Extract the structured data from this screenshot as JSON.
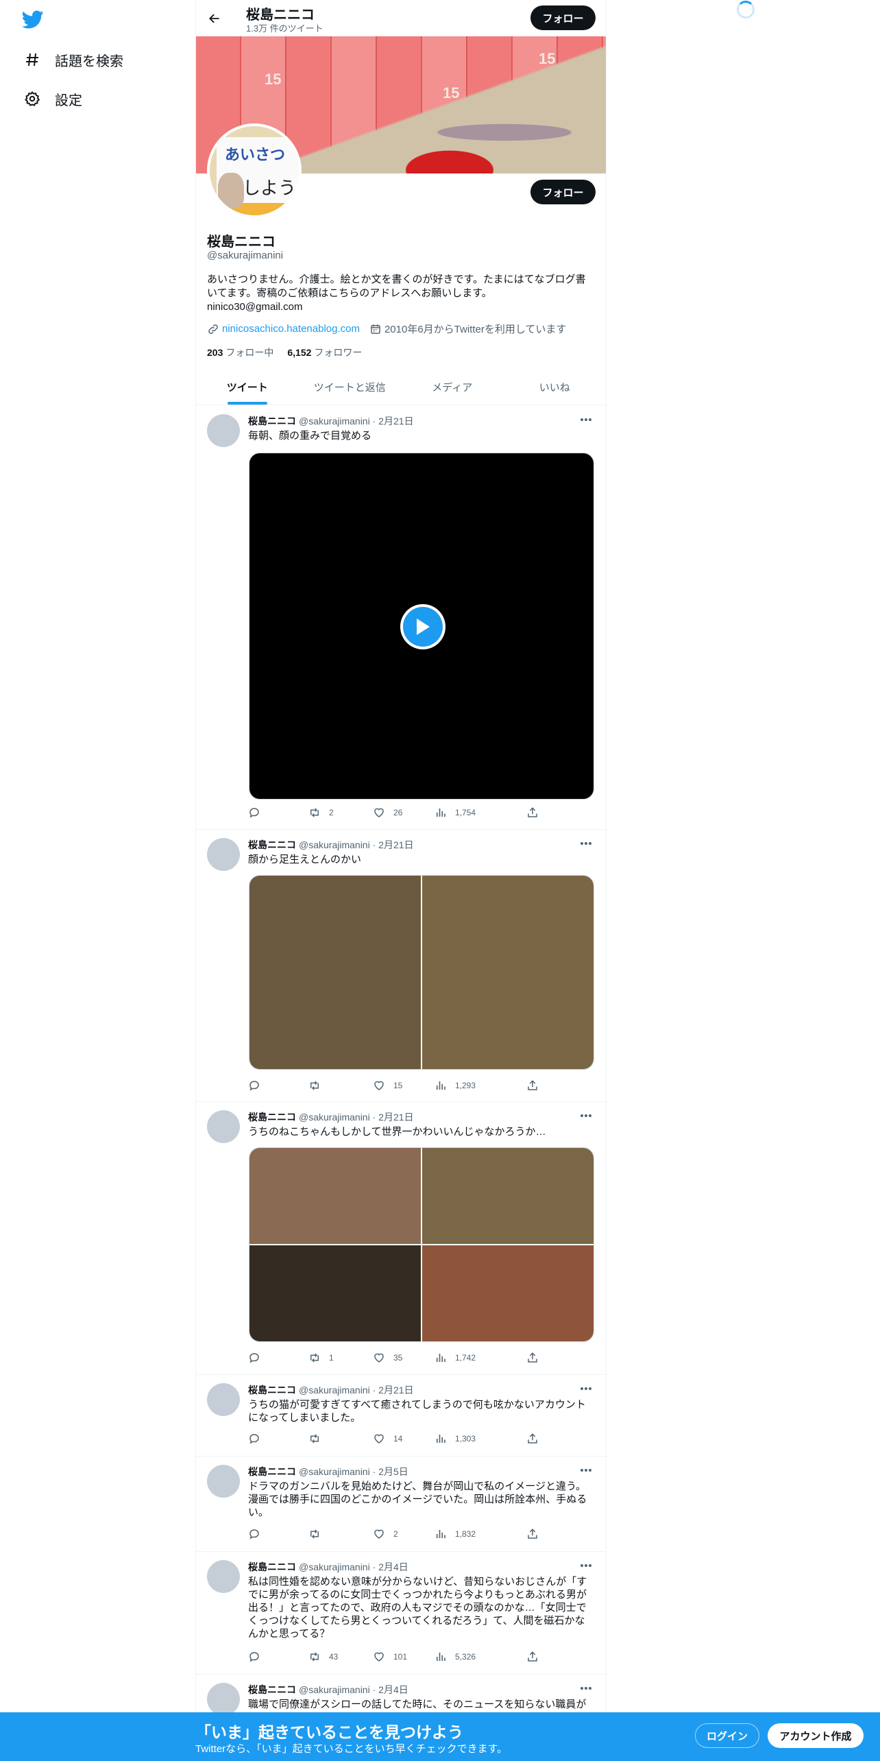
{
  "nav": {
    "logo_icon": "twitter-bird-icon",
    "items": [
      {
        "label": "話題を検索",
        "icon": "hashtag-icon"
      },
      {
        "label": "設定",
        "icon": "gear-icon"
      }
    ]
  },
  "header": {
    "name": "桜島ニニコ",
    "tweet_count": "1.3万 件のツイート",
    "follow_label": "フォロー"
  },
  "profile": {
    "banner_stamp_text": "15",
    "avatar_text_1": "あいさつ",
    "avatar_text_2": "しよう",
    "name": "桜島ニニコ",
    "handle": "@sakurajimanini",
    "bio_line1": "あいさつりません。介護士。絵とか文を書くのが好きです。たまにはてなブログ書いてます。寄稿のご依頼はこちらのアドレスへお願いします。",
    "bio_line2": "ninico30@gmail.com",
    "link": "ninicosachico.hatenablog.com",
    "joined": "2010年6月からTwitterを利用しています",
    "following_count": "203",
    "following_label": "フォロー中",
    "followers_count": "6,152",
    "followers_label": "フォロワー",
    "follow_label": "フォロー"
  },
  "tabs": [
    "ツイート",
    "ツイートと返信",
    "メディア",
    "いいね"
  ],
  "tweets": [
    {
      "name": "桜島ニニコ",
      "handle": "@sakurajimanini",
      "date": "2月21日",
      "text": "毎朝、顔の重みで目覚める",
      "reply": "",
      "retweet": "2",
      "like": "26",
      "views": "1,754"
    },
    {
      "name": "桜島ニニコ",
      "handle": "@sakurajimanini",
      "date": "2月21日",
      "text": "顔から足生えとんのかい",
      "reply": "",
      "retweet": "",
      "like": "15",
      "views": "1,293"
    },
    {
      "name": "桜島ニニコ",
      "handle": "@sakurajimanini",
      "date": "2月21日",
      "text": "うちのねこちゃんもしかして世界一かわいいんじゃなかろうか…",
      "reply": "",
      "retweet": "1",
      "like": "35",
      "views": "1,742"
    },
    {
      "name": "桜島ニニコ",
      "handle": "@sakurajimanini",
      "date": "2月21日",
      "text": "うちの猫が可愛すぎてすべて癒されてしまうので何も呟かないアカウントになってしまいました。",
      "reply": "",
      "retweet": "",
      "like": "14",
      "views": "1,303"
    },
    {
      "name": "桜島ニニコ",
      "handle": "@sakurajimanini",
      "date": "2月5日",
      "text": "ドラマのガンニバルを見始めたけど、舞台が岡山で私のイメージと違う。漫画では勝手に四国のどこかのイメージでいた。岡山は所詮本州、手ぬるい。",
      "reply": "",
      "retweet": "",
      "like": "2",
      "views": "1,832"
    },
    {
      "name": "桜島ニニコ",
      "handle": "@sakurajimanini",
      "date": "2月4日",
      "text": "私は同性婚を認めない意味が分からないけど、昔知らないおじさんが「すでに男が余ってるのに女同士でくっつかれたら今よりもっとあぶれる男が出る！」と言ってたので、政府の人もマジでその頭なのかな…「女同士でくっつけなくしてたら男とくっついてくれるだろう」て、人間を磁石かなんかと思ってる？",
      "reply": "",
      "retweet": "43",
      "like": "101",
      "views": "5,326"
    },
    {
      "name": "桜島ニニコ",
      "handle": "@sakurajimanini",
      "date": "2月4日",
      "text": "職場で同僚達がスシローの話してた時に、そのニュースを知らない職員が"
    }
  ],
  "bottom_bar": {
    "title": "「いま」起きていることを見つけよう",
    "subtitle": "Twitterなら、「いま」起きていることをいち早くチェックできます。",
    "login": "ログイン",
    "signup": "アカウント作成"
  },
  "colors": {
    "accent": "#1d9bf0",
    "text_primary": "#0f1419",
    "text_secondary": "#536471",
    "button_dark": "#0f1419",
    "media_photo_colors": [
      "#6b5a40",
      "#7a6645",
      "#8a6a53",
      "#7a6747",
      "#342c22",
      "#8f553b"
    ]
  }
}
